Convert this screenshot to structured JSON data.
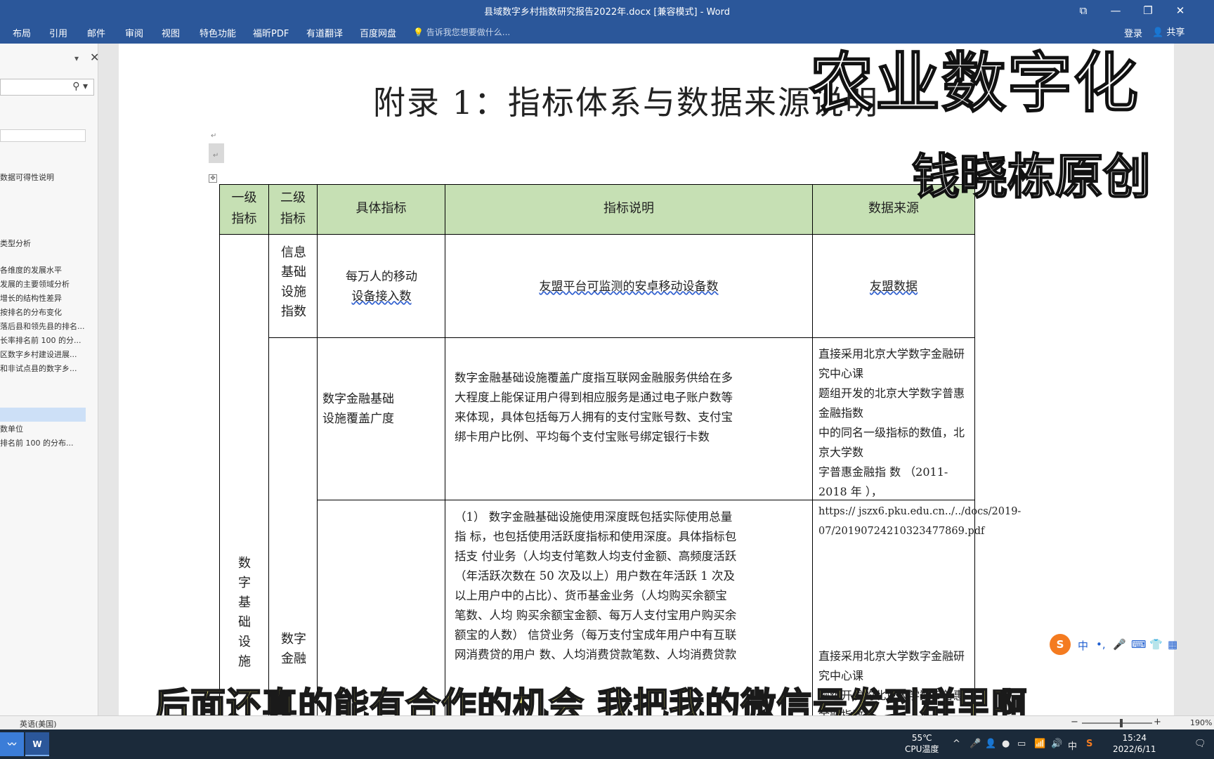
{
  "window": {
    "title": "县域数字乡村指数研究报告2022年.docx [兼容模式] - Word",
    "controls": [
      "⧉",
      "—",
      "❐",
      "✕"
    ]
  },
  "ribbon": {
    "tabs": [
      "布局",
      "引用",
      "邮件",
      "审阅",
      "视图",
      "特色功能",
      "福昕PDF",
      "有道翻译",
      "百度网盘"
    ],
    "tell_me": "告诉我您想要做什么...",
    "login": "登录",
    "share": "共享"
  },
  "nav_pane": {
    "items": [
      "数据可得性说明",
      "类型分析",
      "各维度的发展水平",
      "发展的主要领域分析",
      "增长的结构性差异",
      "按排名的分布变化",
      "落后县和领先县的排名...",
      "长率排名前 100 的分...",
      "区数字乡村建设进展...",
      "和非试点县的数字乡...",
      "数单位",
      "排名前 100 的分布..."
    ]
  },
  "document": {
    "title": "附录 1：指标体系与数据来源说明",
    "para_mark": "↵",
    "table_anchor": "✥",
    "table": {
      "headers": {
        "level1": [
          "一级",
          "指标"
        ],
        "level2": [
          "二级",
          "指标"
        ],
        "specific": "具体指标",
        "description": "指标说明",
        "source": "数据来源"
      },
      "level1_value": [
        "数",
        "字",
        "基",
        "础",
        "设",
        "施"
      ],
      "row1": {
        "level2": [
          "信息",
          "基础",
          "设施",
          "指数"
        ],
        "specific": [
          "每万人的移动",
          "设备接入数"
        ],
        "description": "友盟平台可监测的安卓移动设备数",
        "source": "友盟数据"
      },
      "row2": {
        "specific": [
          "数字金融基础",
          "设施覆盖广度"
        ],
        "description": [
          "数字金融基础设施覆盖广度指互联网金融服务供给在多",
          "大程度上能保证用户得到相应服务是通过电子账户数等",
          "来体现，具体包括每万人拥有的支付宝账号数、支付宝",
          "绑卡用户比例、平均每个支付宝账号绑定银行卡数"
        ],
        "source": [
          "直接采用北京大学数字金融研究中心课",
          "题组开发的北京大学数字普惠金融指数",
          "中的同名一级指标的数值，北京大学数",
          "字普惠金融指 数 （2011-2018 年 ），",
          "https://      jszx6.pku.edu.cn../../docs/2019-",
          "07/20190724210323477869.pdf"
        ]
      },
      "row3": {
        "level2": [
          "数字",
          "金融"
        ],
        "description": [
          "（1） 数字金融基础设施使用深度既包括实际使用总量",
          "指 标，也包括使用活跃度指标和使用深度。具体指标包",
          "括支 付业务（人均支付笔数人均支付金额、高频度活跃",
          "（年活跃次数在 50 次及以上）用户数在年活跃 1 次及",
          "以上用户中的占比）、货币基金业务（人均购买余额宝",
          "笔数、人均 购买余额宝金额、每万人支付宝用户购买余",
          "额宝的人数） 信贷业务（每万支付宝成年用户中有互联",
          "网消费贷的用户 数、人均消费贷款笔数、人均消费贷款"
        ],
        "source": [
          "直接采用北京大学数字金融研究中心课",
          "题组开发的北京大学数字普惠金融指数"
        ]
      }
    }
  },
  "overlays": {
    "watermark_main": "农业数字化",
    "watermark_author": "钱晓栋原创",
    "subtitle": "后面还真的能有合作的机会  我把我的微信号发到群里啊"
  },
  "ime_bar": {
    "logo": "S",
    "items": [
      "中",
      "•,",
      "🎤",
      "⌨",
      "👕",
      "▦"
    ]
  },
  "status_bar": {
    "language": "英语(美国)",
    "zoom": "190%"
  },
  "taskbar": {
    "apps": [
      "W"
    ],
    "cpu_temp": "55℃",
    "cpu_label": "CPU温度",
    "tray": [
      "^",
      "🎤",
      "👤",
      "●",
      "▭",
      "📶",
      "🔊",
      "中",
      "S"
    ],
    "time": "15:24",
    "date": "2022/6/11"
  },
  "colors": {
    "ribbon_blue": "#2b579a",
    "header_green": "#c6e0b4",
    "subtitle_yellow": "#f4f07a"
  }
}
